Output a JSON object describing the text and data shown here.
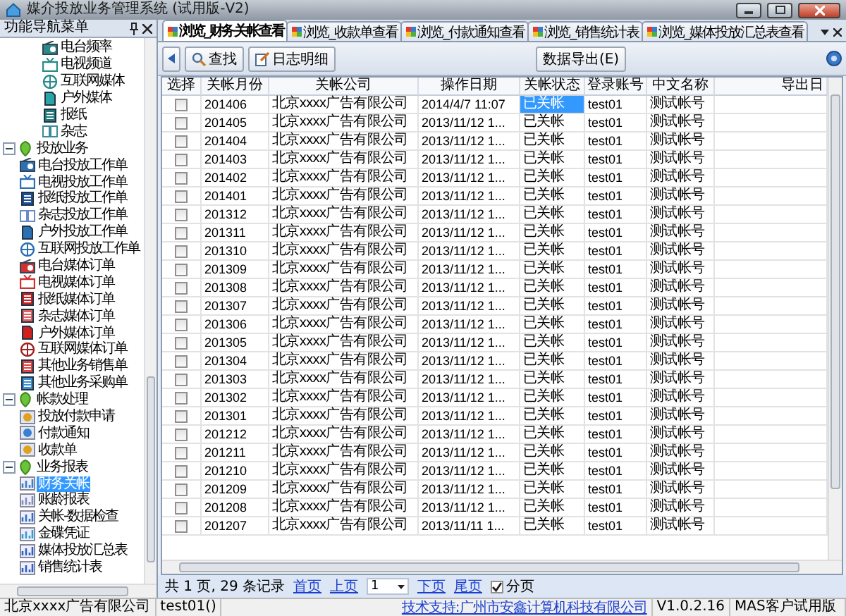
{
  "window": {
    "title": "媒介投放业务管理系统 (试用版-V2)"
  },
  "sidebar": {
    "title": "功能导航菜单",
    "continued_items": [
      {
        "label": "电台频率",
        "selected": false
      },
      {
        "label": "电视频道",
        "selected": false
      },
      {
        "label": "互联网媒体",
        "selected": false
      },
      {
        "label": "户外媒体",
        "selected": false
      },
      {
        "label": "报纸",
        "selected": false
      },
      {
        "label": "杂志",
        "selected": false
      }
    ],
    "groups": [
      {
        "label": "投放业务",
        "expanded": true,
        "children": [
          {
            "label": "电台投放工作单",
            "selected": false
          },
          {
            "label": "电视投放工作单",
            "selected": false
          },
          {
            "label": "报纸投放工作单",
            "selected": false
          },
          {
            "label": "杂志投放工作单",
            "selected": false
          },
          {
            "label": "户外投放工作单",
            "selected": false
          },
          {
            "label": "互联网投放工作单",
            "selected": false
          },
          {
            "label": "电台媒体订单",
            "selected": false
          },
          {
            "label": "电视媒体订单",
            "selected": false
          },
          {
            "label": "报纸媒体订单",
            "selected": false
          },
          {
            "label": "杂志媒体订单",
            "selected": false
          },
          {
            "label": "户外媒体订单",
            "selected": false
          },
          {
            "label": "互联网媒体订单",
            "selected": false
          },
          {
            "label": "其他业务销售单",
            "selected": false
          },
          {
            "label": "其他业务采购单",
            "selected": false
          }
        ]
      },
      {
        "label": "帐款处理",
        "expanded": true,
        "children": [
          {
            "label": "投放付款申请",
            "selected": false
          },
          {
            "label": "付款通知",
            "selected": false
          },
          {
            "label": "收款单",
            "selected": false
          }
        ]
      },
      {
        "label": "业务报表",
        "expanded": true,
        "children": [
          {
            "label": "财务关帐",
            "selected": true
          },
          {
            "label": "账龄报表",
            "selected": false
          },
          {
            "label": "关帐-数据检查",
            "selected": false
          },
          {
            "label": "金碟凭证",
            "selected": false
          },
          {
            "label": "媒体投放汇总表",
            "selected": false
          },
          {
            "label": "销售统计表",
            "selected": false
          }
        ]
      }
    ]
  },
  "tabs": [
    {
      "label": "浏览_财务关帐查看",
      "selected": true
    },
    {
      "label": "浏览_收款单查看",
      "selected": false
    },
    {
      "label": "浏览_付款通知查看",
      "selected": false
    },
    {
      "label": "浏览_销售统计表",
      "selected": false
    },
    {
      "label": "浏览_媒体投放汇总表查看",
      "selected": false
    }
  ],
  "toolbar": {
    "buttons": [
      {
        "kind": "search",
        "label": "查找"
      },
      {
        "kind": "log",
        "label": "日志明细"
      },
      {
        "kind": "export",
        "label": "数据导出(E)"
      }
    ]
  },
  "table": {
    "columns": [
      "选择",
      "关帐月份",
      "关帐公司",
      "操作日期",
      "关帐状态",
      "登录账号",
      "中文名称",
      "导出日"
    ],
    "rows": [
      {
        "checked": false,
        "selected": true,
        "month": "201406",
        "company": "北京xxxx广告有限公司",
        "date": "2014/4/7 11:07",
        "status": "已关帐",
        "login": "test01",
        "name": "测试帐号"
      },
      {
        "checked": false,
        "selected": false,
        "month": "201405",
        "company": "北京xxxx广告有限公司",
        "date": "2013/11/12 1...",
        "status": "已关帐",
        "login": "test01",
        "name": "测试帐号"
      },
      {
        "checked": false,
        "selected": false,
        "month": "201404",
        "company": "北京xxxx广告有限公司",
        "date": "2013/11/12 1...",
        "status": "已关帐",
        "login": "test01",
        "name": "测试帐号"
      },
      {
        "checked": false,
        "selected": false,
        "month": "201403",
        "company": "北京xxxx广告有限公司",
        "date": "2013/11/12 1...",
        "status": "已关帐",
        "login": "test01",
        "name": "测试帐号"
      },
      {
        "checked": false,
        "selected": false,
        "month": "201402",
        "company": "北京xxxx广告有限公司",
        "date": "2013/11/12 1...",
        "status": "已关帐",
        "login": "test01",
        "name": "测试帐号"
      },
      {
        "checked": false,
        "selected": false,
        "month": "201401",
        "company": "北京xxxx广告有限公司",
        "date": "2013/11/12 1...",
        "status": "已关帐",
        "login": "test01",
        "name": "测试帐号"
      },
      {
        "checked": false,
        "selected": false,
        "month": "201312",
        "company": "北京xxxx广告有限公司",
        "date": "2013/11/12 1...",
        "status": "已关帐",
        "login": "test01",
        "name": "测试帐号"
      },
      {
        "checked": false,
        "selected": false,
        "month": "201311",
        "company": "北京xxxx广告有限公司",
        "date": "2013/11/12 1...",
        "status": "已关帐",
        "login": "test01",
        "name": "测试帐号"
      },
      {
        "checked": false,
        "selected": false,
        "month": "201310",
        "company": "北京xxxx广告有限公司",
        "date": "2013/11/12 1...",
        "status": "已关帐",
        "login": "test01",
        "name": "测试帐号"
      },
      {
        "checked": false,
        "selected": false,
        "month": "201309",
        "company": "北京xxxx广告有限公司",
        "date": "2013/11/12 1...",
        "status": "已关帐",
        "login": "test01",
        "name": "测试帐号"
      },
      {
        "checked": false,
        "selected": false,
        "month": "201308",
        "company": "北京xxxx广告有限公司",
        "date": "2013/11/12 1...",
        "status": "已关帐",
        "login": "test01",
        "name": "测试帐号"
      },
      {
        "checked": false,
        "selected": false,
        "month": "201307",
        "company": "北京xxxx广告有限公司",
        "date": "2013/11/12 1...",
        "status": "已关帐",
        "login": "test01",
        "name": "测试帐号"
      },
      {
        "checked": false,
        "selected": false,
        "month": "201306",
        "company": "北京xxxx广告有限公司",
        "date": "2013/11/12 1...",
        "status": "已关帐",
        "login": "test01",
        "name": "测试帐号"
      },
      {
        "checked": false,
        "selected": false,
        "month": "201305",
        "company": "北京xxxx广告有限公司",
        "date": "2013/11/12 1...",
        "status": "已关帐",
        "login": "test01",
        "name": "测试帐号"
      },
      {
        "checked": false,
        "selected": false,
        "month": "201304",
        "company": "北京xxxx广告有限公司",
        "date": "2013/11/12 1...",
        "status": "已关帐",
        "login": "test01",
        "name": "测试帐号"
      },
      {
        "checked": false,
        "selected": false,
        "month": "201303",
        "company": "北京xxxx广告有限公司",
        "date": "2013/11/12 1...",
        "status": "已关帐",
        "login": "test01",
        "name": "测试帐号"
      },
      {
        "checked": false,
        "selected": false,
        "month": "201302",
        "company": "北京xxxx广告有限公司",
        "date": "2013/11/12 1...",
        "status": "已关帐",
        "login": "test01",
        "name": "测试帐号"
      },
      {
        "checked": false,
        "selected": false,
        "month": "201301",
        "company": "北京xxxx广告有限公司",
        "date": "2013/11/12 1...",
        "status": "已关帐",
        "login": "test01",
        "name": "测试帐号"
      },
      {
        "checked": false,
        "selected": false,
        "month": "201212",
        "company": "北京xxxx广告有限公司",
        "date": "2013/11/12 1...",
        "status": "已关帐",
        "login": "test01",
        "name": "测试帐号"
      },
      {
        "checked": false,
        "selected": false,
        "month": "201211",
        "company": "北京xxxx广告有限公司",
        "date": "2013/11/12 1...",
        "status": "已关帐",
        "login": "test01",
        "name": "测试帐号"
      },
      {
        "checked": false,
        "selected": false,
        "month": "201210",
        "company": "北京xxxx广告有限公司",
        "date": "2013/11/12 1...",
        "status": "已关帐",
        "login": "test01",
        "name": "测试帐号"
      },
      {
        "checked": false,
        "selected": false,
        "month": "201209",
        "company": "北京xxxx广告有限公司",
        "date": "2013/11/12 1...",
        "status": "已关帐",
        "login": "test01",
        "name": "测试帐号"
      },
      {
        "checked": false,
        "selected": false,
        "month": "201208",
        "company": "北京xxxx广告有限公司",
        "date": "2013/11/12 1...",
        "status": "已关帐",
        "login": "test01",
        "name": "测试帐号"
      },
      {
        "checked": false,
        "selected": false,
        "month": "201207",
        "company": "北京xxxx广告有限公司",
        "date": "2013/11/11 1...",
        "status": "已关帐",
        "login": "test01",
        "name": "测试帐号"
      }
    ]
  },
  "pager": {
    "summary": "共 1 页, 29 条记录",
    "first": "首页",
    "prev": "上页",
    "page": "1",
    "next": "下页",
    "last": "尾页",
    "paging": {
      "label": "分页",
      "checked": true
    }
  },
  "status_bar": {
    "company": "北京xxxx广告有限公司",
    "user": "test01()",
    "support_link": "技术支持:广州市安鑫计算机科技有限公司",
    "version": "V1.0.2.16",
    "edition": "MAS客户试用版"
  }
}
